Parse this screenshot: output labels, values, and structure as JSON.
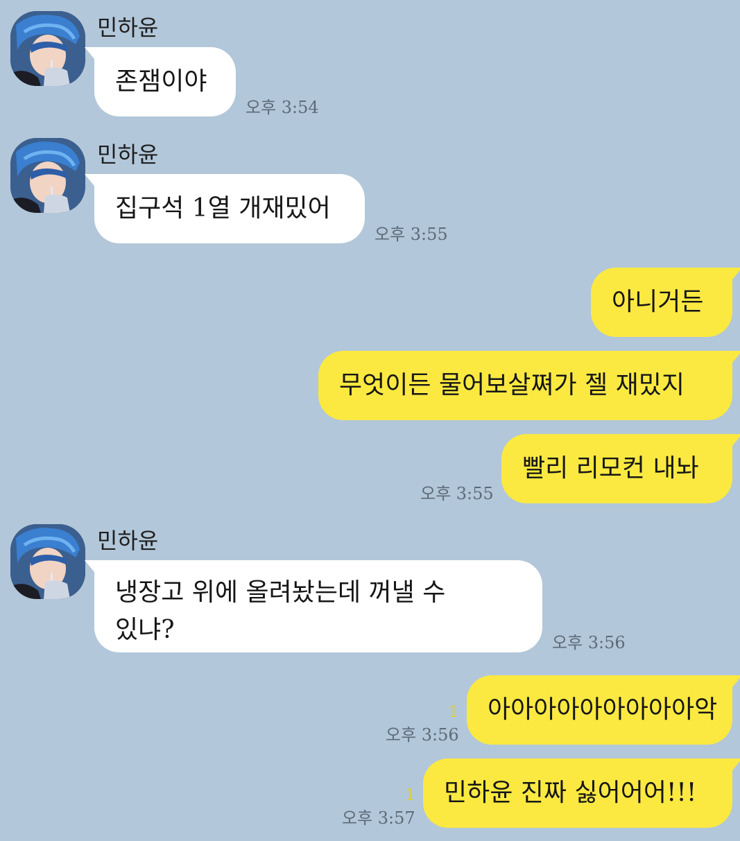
{
  "messages": [
    {
      "sender": "민하윤",
      "text": "존잼이야",
      "time": "오후 3:54"
    },
    {
      "sender": "민하윤",
      "text": "집구석 1열 개재밌어",
      "time": "오후 3:55"
    },
    {
      "text": "아니거든"
    },
    {
      "text": "무엇이든 물어보살쪄가 젤 재밌지"
    },
    {
      "text": "빨리 리모컨 내놔",
      "time": "오후 3:55"
    },
    {
      "sender": "민하윤",
      "text_line1": "냉장고 위에 올려놨는데 꺼낼 수",
      "text_line2": "있냐?",
      "time": "오후 3:56"
    },
    {
      "text": "아아아아아아아아아악",
      "unread": "1",
      "time": "오후 3:56"
    },
    {
      "text": "민하윤 진짜 싫어어어!!!",
      "unread": "1",
      "time": "오후 3:57"
    }
  ],
  "colors": {
    "background": "#b2c7d9",
    "incoming_bubble": "#ffffff",
    "outgoing_bubble": "#fbe941",
    "unread_count": "#e8d000"
  }
}
